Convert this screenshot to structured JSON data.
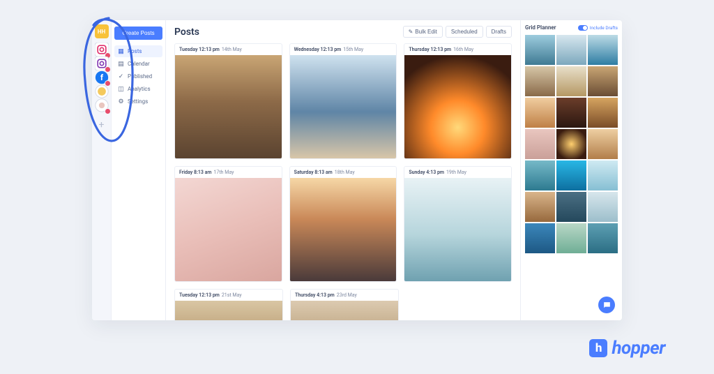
{
  "rail": {
    "user_initials": "HH",
    "accounts": [
      {
        "name": "account-instagram-1",
        "badge": true
      },
      {
        "name": "account-instagram-2",
        "badge": true
      },
      {
        "name": "account-facebook",
        "badge": true
      },
      {
        "name": "account-twitter",
        "badge": false
      },
      {
        "name": "account-extra",
        "badge": true
      }
    ]
  },
  "nav": {
    "create_label": "Create Posts",
    "items": [
      {
        "icon": "grid-icon",
        "label": "Posts",
        "active": true
      },
      {
        "icon": "calendar-icon",
        "label": "Calendar",
        "active": false
      },
      {
        "icon": "check-icon",
        "label": "Published",
        "active": false
      },
      {
        "icon": "chart-icon",
        "label": "Analytics",
        "active": false
      },
      {
        "icon": "gear-icon",
        "label": "Settings",
        "active": false
      }
    ]
  },
  "header": {
    "title": "Posts",
    "bulk_edit": "Bulk Edit",
    "scheduled": "Scheduled",
    "drafts": "Drafts"
  },
  "posts": [
    [
      {
        "time": "Tuesday 12:13 pm",
        "date": "14th May",
        "gradient": "linear-gradient(180deg,#c9a574 0%,#8d6a48 45%,#5a4330 100%)"
      },
      {
        "time": "Wednesday 12:13 pm",
        "date": "15th May",
        "gradient": "linear-gradient(180deg,#cfe2ef 0%,#5f85a6 55%,#d8c6a8 100%)"
      },
      {
        "time": "Thursday 12:13 pm",
        "date": "16th May",
        "gradient": "radial-gradient(circle at 50% 70%,#ffd97a 0%,#ff8a2a 30%,#3a1c10 80%)"
      }
    ],
    [
      {
        "time": "Friday 8:13 am",
        "date": "17th May",
        "gradient": "linear-gradient(160deg,#f3d7d3 0%,#e9beb8 50%,#d9a69f 100%)"
      },
      {
        "time": "Saturday 8:13 am",
        "date": "18th May",
        "gradient": "linear-gradient(180deg,#f6d7a6 0%,#c98858 40%,#4a3a3a 100%)"
      },
      {
        "time": "Sunday 4:13 pm",
        "date": "19th May",
        "gradient": "linear-gradient(180deg,#e8f2f5 0%,#b6d5dc 55%,#6fa1b0 100%)"
      }
    ],
    [
      {
        "time": "Tuesday 12:13 pm",
        "date": "21st May",
        "gradient": "linear-gradient(180deg,#d9c6a3 0%,#b89b72 100%)"
      },
      {
        "time": "Thursday 4:13 pm",
        "date": "23rd May",
        "gradient": "linear-gradient(180deg,#dccab0 0%,#b9a07b 100%)"
      }
    ]
  ],
  "planner": {
    "title": "Grid Planner",
    "include_drafts": "Include Drafts",
    "cells": [
      "linear-gradient(180deg,#9dccde,#3f7a93)",
      "linear-gradient(180deg,#d7e7ef,#7ca8bd)",
      "linear-gradient(180deg,#bcdbe6,#2e7da3)",
      "linear-gradient(180deg,#d6c6a7,#8a6a49)",
      "linear-gradient(180deg,#e8dfc9,#b59864)",
      "linear-gradient(180deg,#c9a574,#6a4d34)",
      "linear-gradient(180deg,#f0cda0,#bf8046)",
      "linear-gradient(180deg,#6b3d2a,#2b1710)",
      "linear-gradient(180deg,#d6a460,#7a4d28)",
      "linear-gradient(180deg,#e9c6bf,#caa099)",
      "radial-gradient(circle,#ffcf6e,#3a1c10 75%)",
      "linear-gradient(180deg,#eecfa2,#b27e4a)",
      "linear-gradient(180deg,#76b9c8,#2d7a90)",
      "linear-gradient(180deg,#29b7e5,#0d6fa0)",
      "linear-gradient(180deg,#cfeaf2,#86bfd3)",
      "linear-gradient(180deg,#d9b58b,#97693d)",
      "linear-gradient(180deg,#4b6f83,#24485c)",
      "linear-gradient(180deg,#d7e6ec,#9cbecb)",
      "linear-gradient(180deg,#3b87bb,#1d5884)",
      "linear-gradient(180deg,#b9d7c7,#6fae95)",
      "linear-gradient(180deg,#5d9fb3,#2b6e84)"
    ]
  },
  "brand": {
    "text": "hopper",
    "mark": "h"
  }
}
